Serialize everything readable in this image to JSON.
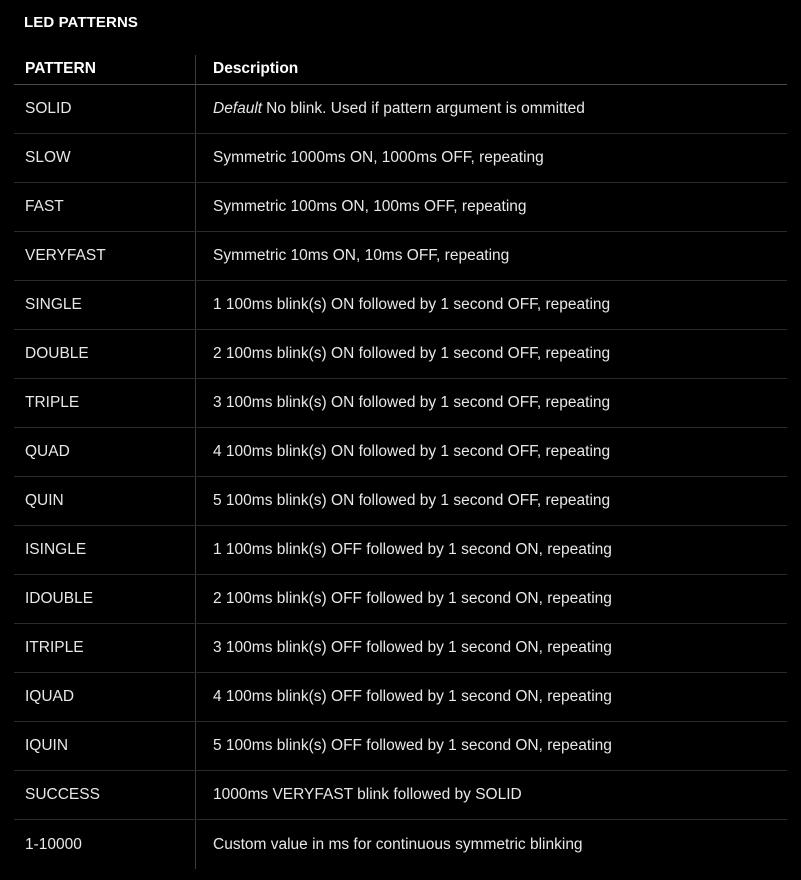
{
  "section_title": "LED PATTERNS",
  "table": {
    "headers": {
      "pattern": "PATTERN",
      "description": "Description"
    },
    "rows": [
      {
        "pattern": "SOLID",
        "emphasis": "Default",
        "description": "No blink. Used if pattern argument is ommitted"
      },
      {
        "pattern": "SLOW",
        "description": "Symmetric 1000ms ON, 1000ms OFF, repeating"
      },
      {
        "pattern": "FAST",
        "description": "Symmetric 100ms ON, 100ms OFF, repeating"
      },
      {
        "pattern": "VERYFAST",
        "description": "Symmetric 10ms ON, 10ms OFF, repeating"
      },
      {
        "pattern": "SINGLE",
        "description": "1 100ms blink(s) ON followed by 1 second OFF, repeating"
      },
      {
        "pattern": "DOUBLE",
        "description": "2 100ms blink(s) ON followed by 1 second OFF, repeating"
      },
      {
        "pattern": "TRIPLE",
        "description": "3 100ms blink(s) ON followed by 1 second OFF, repeating"
      },
      {
        "pattern": "QUAD",
        "description": "4 100ms blink(s) ON followed by 1 second OFF, repeating"
      },
      {
        "pattern": "QUIN",
        "description": "5 100ms blink(s) ON followed by 1 second OFF, repeating"
      },
      {
        "pattern": "ISINGLE",
        "description": "1 100ms blink(s) OFF followed by 1 second ON, repeating"
      },
      {
        "pattern": "IDOUBLE",
        "description": "2 100ms blink(s) OFF followed by 1 second ON, repeating"
      },
      {
        "pattern": "ITRIPLE",
        "description": "3 100ms blink(s) OFF followed by 1 second ON, repeating"
      },
      {
        "pattern": "IQUAD",
        "description": "4 100ms blink(s) OFF followed by 1 second ON, repeating"
      },
      {
        "pattern": "IQUIN",
        "description": "5 100ms blink(s) OFF followed by 1 second ON, repeating"
      },
      {
        "pattern": "SUCCESS",
        "description": "1000ms VERYFAST blink followed by SOLID"
      },
      {
        "pattern": "1-10000",
        "description": "Custom value in ms for continuous symmetric blinking"
      }
    ]
  }
}
